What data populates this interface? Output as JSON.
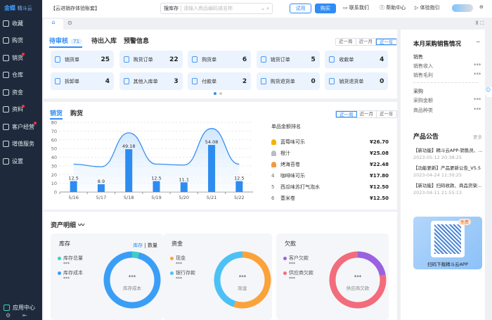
{
  "sidebar": {
    "logo": "金蝶",
    "logo_sub": "精斗云",
    "items": [
      {
        "label": "收藏",
        "badge": false
      },
      {
        "label": "购货",
        "badge": false
      },
      {
        "label": "销货",
        "badge": true
      },
      {
        "label": "仓库",
        "badge": false
      },
      {
        "label": "资金",
        "badge": false
      },
      {
        "label": "资料",
        "badge": true
      },
      {
        "label": "客户经营",
        "badge": true
      },
      {
        "label": "增值服务",
        "badge": false
      },
      {
        "label": "设置",
        "badge": false
      }
    ],
    "app_center": "应用中心"
  },
  "topbar": {
    "account": "【云进销存体验账套】",
    "search_scope": "搜库存",
    "search_placeholder": "请输入商品编码或名称",
    "trial": "试用",
    "buy": "购买",
    "contact": "联系我们",
    "help": "帮助中心",
    "guide": "体验指引"
  },
  "pending": {
    "tabs": [
      {
        "label": "待审核",
        "count": "71"
      },
      {
        "label": "待出入库"
      },
      {
        "label": "预警信息"
      }
    ],
    "ranges": [
      "近一周",
      "近一月",
      "近一年"
    ],
    "cards": [
      {
        "label": "销货单",
        "value": "25"
      },
      {
        "label": "购货订单",
        "value": "22"
      },
      {
        "label": "购货单",
        "value": "6"
      },
      {
        "label": "销货订单",
        "value": "5"
      },
      {
        "label": "收款单",
        "value": "4"
      },
      {
        "label": "拆卸单",
        "value": "4"
      },
      {
        "label": "其他入库单",
        "value": "3"
      },
      {
        "label": "付款单",
        "value": "2"
      },
      {
        "label": "购货退货单",
        "value": "0"
      },
      {
        "label": "销货退货单",
        "value": "0"
      }
    ]
  },
  "sales": {
    "tabs": [
      "销货",
      "购货"
    ],
    "ranges": [
      "近一周",
      "近一月",
      "近一年"
    ],
    "ranking_title": "单品金额排名",
    "ranking": [
      {
        "rank": "1",
        "name": "蓝莓味可乐",
        "amount": "¥26.70"
      },
      {
        "rank": "2",
        "name": "橙汁",
        "amount": "¥25.08"
      },
      {
        "rank": "3",
        "name": "烤海苔卷",
        "amount": "¥22.48"
      },
      {
        "rank": "4",
        "name": "咖啡味可乐",
        "amount": "¥17.80"
      },
      {
        "rank": "5",
        "name": "西瓜味苏打气泡水",
        "amount": "¥12.50"
      },
      {
        "rank": "6",
        "name": "薏米卷",
        "amount": "¥12.50"
      }
    ]
  },
  "chart_data": {
    "type": "bar",
    "categories": [
      "5/16",
      "5/17",
      "5/18",
      "5/19",
      "5/20",
      "5/21",
      "5/22"
    ],
    "series": [
      {
        "name": "bar",
        "values": [
          12.5,
          8.9,
          49.18,
          12.5,
          11.1,
          54.08,
          12.5
        ]
      },
      {
        "name": "line",
        "values": [
          32,
          29,
          68,
          32,
          31,
          73,
          32
        ]
      }
    ],
    "ylim": [
      0,
      80
    ],
    "yticks": [
      0,
      10,
      20,
      30,
      40,
      50,
      60,
      70,
      80
    ],
    "xlabel": "",
    "ylabel": "",
    "title": ""
  },
  "assets": {
    "title": "资产明细",
    "inventory": {
      "title": "库存",
      "toggle": [
        "库存",
        "数量"
      ],
      "items": [
        {
          "label": "库存总量",
          "value": "***",
          "color": "#3ccfc0",
          "share": 0.04
        },
        {
          "label": "库存成本",
          "value": "***",
          "color": "#3a9ef7",
          "share": 0.96
        }
      ],
      "center_value": "***",
      "center_label": "库存成本"
    },
    "funds": {
      "title": "资金",
      "items": [
        {
          "label": "现金",
          "value": "***",
          "color": "#fba33a",
          "share": 0.55
        },
        {
          "label": "银行存款",
          "value": "***",
          "color": "#4cc1f5",
          "share": 0.45
        }
      ],
      "center_value": "***",
      "center_label": "现金"
    },
    "debts": {
      "title": "欠款",
      "items": [
        {
          "label": "客户欠款",
          "value": "***",
          "color": "#9a62e0",
          "share": 0.22
        },
        {
          "label": "供应商欠款",
          "value": "***",
          "color": "#f36c7c",
          "share": 0.78
        }
      ],
      "center_value": "***",
      "center_label": "供应商欠款"
    }
  },
  "summary": {
    "title": "本月采购销售情况",
    "sales": "销售",
    "sales_income": "销售收入",
    "sales_profit": "销售毛利",
    "purchase": "采购",
    "purchase_amount": "采购金额",
    "product_types": "商品种类",
    "masked": "***"
  },
  "notices": {
    "title": "产品公告",
    "more": "更多",
    "items": [
      {
        "title": "【新功能】精斗云APP-销售员、...",
        "date": "2023-05-12 20:38:25"
      },
      {
        "title": "【功能更新】产品更新公告_V5.5",
        "date": "2023-04-24 11:30:25"
      },
      {
        "title": "【新功能】扫码收款、商品货架...",
        "date": "2023-04-11 21:55:13"
      }
    ]
  },
  "promo": {
    "badge": "免费",
    "text": "扫码下载精斗云APP"
  }
}
